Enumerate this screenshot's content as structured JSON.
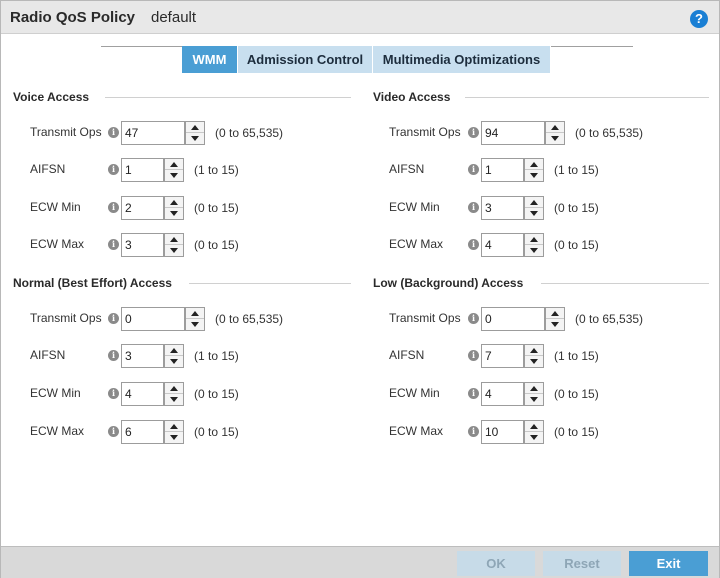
{
  "header": {
    "title": "Radio QoS Policy",
    "subtitle": "default",
    "help_icon": "?"
  },
  "tabs": [
    {
      "label": "WMM",
      "active": true
    },
    {
      "label": "Admission Control",
      "active": false
    },
    {
      "label": "Multimedia Optimizations",
      "active": false
    }
  ],
  "info_glyph": "i",
  "sections": {
    "voice": {
      "title": "Voice Access",
      "transmit_ops": {
        "label": "Transmit Ops",
        "value": "47",
        "range": "(0 to 65,535)"
      },
      "aifsn": {
        "label": "AIFSN",
        "value": "1",
        "range": "(1 to 15)"
      },
      "ecw_min": {
        "label": "ECW Min",
        "value": "2",
        "range": "(0 to 15)"
      },
      "ecw_max": {
        "label": "ECW Max",
        "value": "3",
        "range": "(0 to 15)"
      }
    },
    "video": {
      "title": "Video Access",
      "transmit_ops": {
        "label": "Transmit Ops",
        "value": "94",
        "range": "(0 to 65,535)"
      },
      "aifsn": {
        "label": "AIFSN",
        "value": "1",
        "range": "(1 to 15)"
      },
      "ecw_min": {
        "label": "ECW Min",
        "value": "3",
        "range": "(0 to 15)"
      },
      "ecw_max": {
        "label": "ECW Max",
        "value": "4",
        "range": "(0 to 15)"
      }
    },
    "normal": {
      "title": "Normal (Best Effort) Access",
      "transmit_ops": {
        "label": "Transmit Ops",
        "value": "0",
        "range": "(0 to 65,535)"
      },
      "aifsn": {
        "label": "AIFSN",
        "value": "3",
        "range": "(1 to 15)"
      },
      "ecw_min": {
        "label": "ECW Min",
        "value": "4",
        "range": "(0 to 15)"
      },
      "ecw_max": {
        "label": "ECW Max",
        "value": "6",
        "range": "(0 to 15)"
      }
    },
    "low": {
      "title": "Low (Background) Access",
      "transmit_ops": {
        "label": "Transmit Ops",
        "value": "0",
        "range": "(0 to 65,535)"
      },
      "aifsn": {
        "label": "AIFSN",
        "value": "7",
        "range": "(1 to 15)"
      },
      "ecw_min": {
        "label": "ECW Min",
        "value": "4",
        "range": "(0 to 15)"
      },
      "ecw_max": {
        "label": "ECW Max",
        "value": "10",
        "range": "(0 to 15)"
      }
    }
  },
  "footer": {
    "ok_label": "OK",
    "reset_label": "Reset",
    "exit_label": "Exit"
  },
  "colors": {
    "accent": "#4a9ed4",
    "tab_inactive": "#c8dfef",
    "help": "#1a7fd4"
  }
}
